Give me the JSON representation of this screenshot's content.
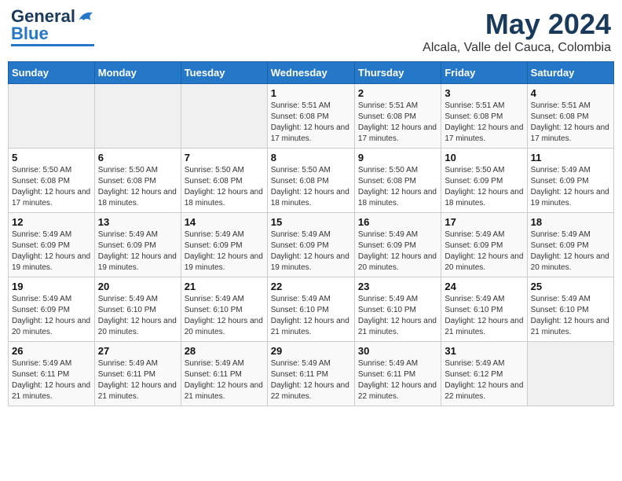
{
  "logo": {
    "general": "General",
    "blue": "Blue"
  },
  "header": {
    "title": "May 2024",
    "subtitle": "Alcala, Valle del Cauca, Colombia"
  },
  "weekdays": [
    "Sunday",
    "Monday",
    "Tuesday",
    "Wednesday",
    "Thursday",
    "Friday",
    "Saturday"
  ],
  "weeks": [
    [
      {
        "day": "",
        "info": ""
      },
      {
        "day": "",
        "info": ""
      },
      {
        "day": "",
        "info": ""
      },
      {
        "day": "1",
        "info": "Sunrise: 5:51 AM\nSunset: 6:08 PM\nDaylight: 12 hours and 17 minutes."
      },
      {
        "day": "2",
        "info": "Sunrise: 5:51 AM\nSunset: 6:08 PM\nDaylight: 12 hours and 17 minutes."
      },
      {
        "day": "3",
        "info": "Sunrise: 5:51 AM\nSunset: 6:08 PM\nDaylight: 12 hours and 17 minutes."
      },
      {
        "day": "4",
        "info": "Sunrise: 5:51 AM\nSunset: 6:08 PM\nDaylight: 12 hours and 17 minutes."
      }
    ],
    [
      {
        "day": "5",
        "info": "Sunrise: 5:50 AM\nSunset: 6:08 PM\nDaylight: 12 hours and 17 minutes."
      },
      {
        "day": "6",
        "info": "Sunrise: 5:50 AM\nSunset: 6:08 PM\nDaylight: 12 hours and 18 minutes."
      },
      {
        "day": "7",
        "info": "Sunrise: 5:50 AM\nSunset: 6:08 PM\nDaylight: 12 hours and 18 minutes."
      },
      {
        "day": "8",
        "info": "Sunrise: 5:50 AM\nSunset: 6:08 PM\nDaylight: 12 hours and 18 minutes."
      },
      {
        "day": "9",
        "info": "Sunrise: 5:50 AM\nSunset: 6:08 PM\nDaylight: 12 hours and 18 minutes."
      },
      {
        "day": "10",
        "info": "Sunrise: 5:50 AM\nSunset: 6:09 PM\nDaylight: 12 hours and 18 minutes."
      },
      {
        "day": "11",
        "info": "Sunrise: 5:49 AM\nSunset: 6:09 PM\nDaylight: 12 hours and 19 minutes."
      }
    ],
    [
      {
        "day": "12",
        "info": "Sunrise: 5:49 AM\nSunset: 6:09 PM\nDaylight: 12 hours and 19 minutes."
      },
      {
        "day": "13",
        "info": "Sunrise: 5:49 AM\nSunset: 6:09 PM\nDaylight: 12 hours and 19 minutes."
      },
      {
        "day": "14",
        "info": "Sunrise: 5:49 AM\nSunset: 6:09 PM\nDaylight: 12 hours and 19 minutes."
      },
      {
        "day": "15",
        "info": "Sunrise: 5:49 AM\nSunset: 6:09 PM\nDaylight: 12 hours and 19 minutes."
      },
      {
        "day": "16",
        "info": "Sunrise: 5:49 AM\nSunset: 6:09 PM\nDaylight: 12 hours and 20 minutes."
      },
      {
        "day": "17",
        "info": "Sunrise: 5:49 AM\nSunset: 6:09 PM\nDaylight: 12 hours and 20 minutes."
      },
      {
        "day": "18",
        "info": "Sunrise: 5:49 AM\nSunset: 6:09 PM\nDaylight: 12 hours and 20 minutes."
      }
    ],
    [
      {
        "day": "19",
        "info": "Sunrise: 5:49 AM\nSunset: 6:09 PM\nDaylight: 12 hours and 20 minutes."
      },
      {
        "day": "20",
        "info": "Sunrise: 5:49 AM\nSunset: 6:10 PM\nDaylight: 12 hours and 20 minutes."
      },
      {
        "day": "21",
        "info": "Sunrise: 5:49 AM\nSunset: 6:10 PM\nDaylight: 12 hours and 20 minutes."
      },
      {
        "day": "22",
        "info": "Sunrise: 5:49 AM\nSunset: 6:10 PM\nDaylight: 12 hours and 21 minutes."
      },
      {
        "day": "23",
        "info": "Sunrise: 5:49 AM\nSunset: 6:10 PM\nDaylight: 12 hours and 21 minutes."
      },
      {
        "day": "24",
        "info": "Sunrise: 5:49 AM\nSunset: 6:10 PM\nDaylight: 12 hours and 21 minutes."
      },
      {
        "day": "25",
        "info": "Sunrise: 5:49 AM\nSunset: 6:10 PM\nDaylight: 12 hours and 21 minutes."
      }
    ],
    [
      {
        "day": "26",
        "info": "Sunrise: 5:49 AM\nSunset: 6:11 PM\nDaylight: 12 hours and 21 minutes."
      },
      {
        "day": "27",
        "info": "Sunrise: 5:49 AM\nSunset: 6:11 PM\nDaylight: 12 hours and 21 minutes."
      },
      {
        "day": "28",
        "info": "Sunrise: 5:49 AM\nSunset: 6:11 PM\nDaylight: 12 hours and 21 minutes."
      },
      {
        "day": "29",
        "info": "Sunrise: 5:49 AM\nSunset: 6:11 PM\nDaylight: 12 hours and 22 minutes."
      },
      {
        "day": "30",
        "info": "Sunrise: 5:49 AM\nSunset: 6:11 PM\nDaylight: 12 hours and 22 minutes."
      },
      {
        "day": "31",
        "info": "Sunrise: 5:49 AM\nSunset: 6:12 PM\nDaylight: 12 hours and 22 minutes."
      },
      {
        "day": "",
        "info": ""
      }
    ]
  ]
}
